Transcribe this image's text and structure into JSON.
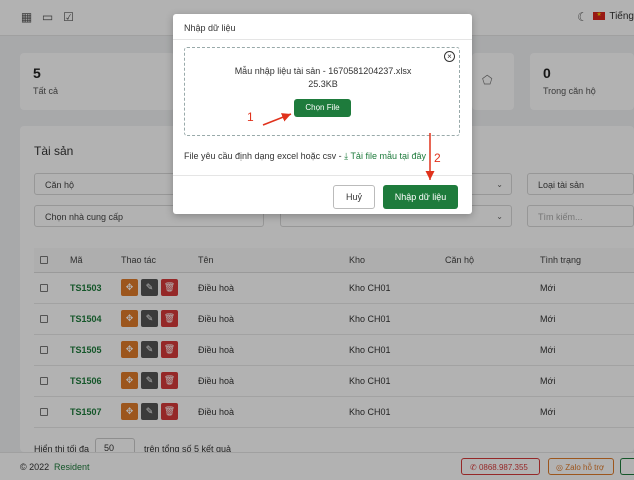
{
  "topbar": {
    "language": "Tiếng"
  },
  "stats": [
    {
      "value": "5",
      "label": "Tất cả"
    },
    {
      "value": "0",
      "label": "Trong căn hộ"
    }
  ],
  "section": {
    "title": "Tài sản"
  },
  "filters": {
    "apartment": "Căn hộ",
    "supplier": "Chọn nhà cung cấp",
    "asset_type": "Loại tài sản",
    "search_placeholder": "Tìm kiếm..."
  },
  "table": {
    "headers": [
      "Mã",
      "Thao tác",
      "Tên",
      "Kho",
      "Căn hộ",
      "Tình trạng"
    ],
    "rows": [
      {
        "code": "TS1503",
        "name": "Điều hoà",
        "warehouse": "Kho CH01",
        "apartment": "",
        "status": "Mới"
      },
      {
        "code": "TS1504",
        "name": "Điều hoà",
        "warehouse": "Kho CH01",
        "apartment": "",
        "status": "Mới"
      },
      {
        "code": "TS1505",
        "name": "Điều hoà",
        "warehouse": "Kho CH01",
        "apartment": "",
        "status": "Mới"
      },
      {
        "code": "TS1506",
        "name": "Điều hoà",
        "warehouse": "Kho CH01",
        "apartment": "",
        "status": "Mới"
      },
      {
        "code": "TS1507",
        "name": "Điều hoà",
        "warehouse": "Kho CH01",
        "apartment": "",
        "status": "Mới"
      }
    ]
  },
  "pagination": {
    "prefix": "Hiển thị tối đa",
    "per_page": "50",
    "suffix": "trên tổng số 5 kết quả"
  },
  "footer": {
    "copyright": "© 2022",
    "brand": "Resident",
    "phone": "0868.987.355",
    "zalo": "Zalo hỗ trợ"
  },
  "modal": {
    "title": "Nhập dữ liệu",
    "file_name": "Mẫu nhập liệu tài sản - 1670581204237.xlsx",
    "file_size": "25.3KB",
    "choose_file": "Chọn File",
    "hint": "File yêu cầu định dạng excel hoặc csv -",
    "template_link": "Tải file mẫu tại đây",
    "cancel": "Huỷ",
    "submit": "Nhập dữ liệu"
  },
  "annotations": {
    "step1": "1",
    "step2": "2"
  },
  "colors": {
    "brand_green": "#1e7b3c",
    "annotation_red": "#e0321c",
    "danger": "#d63a3a",
    "warning": "#e07b2a"
  }
}
